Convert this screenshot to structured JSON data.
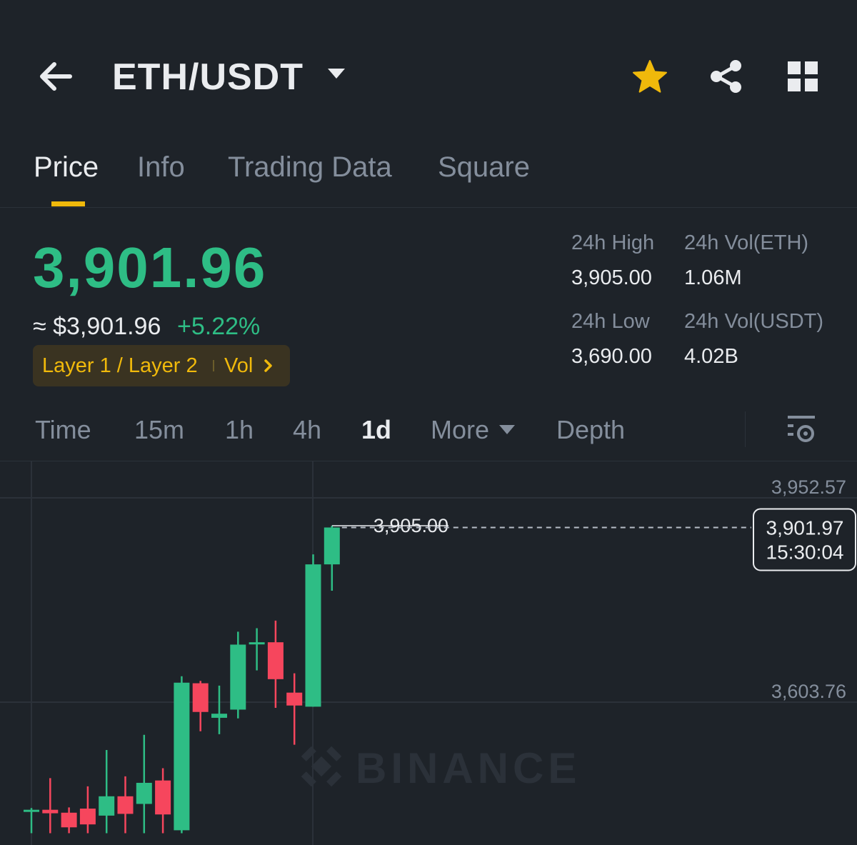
{
  "header": {
    "pair": "ETH/USDT",
    "icons": [
      "arrow-left-icon",
      "caret-down-icon",
      "star-icon",
      "share-icon",
      "grid-icon"
    ],
    "favorite_color": "#f0b90b"
  },
  "tabs": [
    {
      "label": "Price",
      "active": true
    },
    {
      "label": "Info",
      "active": false
    },
    {
      "label": "Trading Data",
      "active": false
    },
    {
      "label": "Square",
      "active": false
    }
  ],
  "ticker": {
    "last_price": "3,901.96",
    "fiat_price": "≈ $3,901.96",
    "change": "+5.22%",
    "tag": "Layer 1 / Layer 2",
    "tag_vol": "Vol",
    "tag_chevron": "›",
    "high_label": "24h High",
    "high_value": "3,905.00",
    "low_label": "24h Low",
    "low_value": "3,690.00",
    "vol_eth_label": "24h Vol(ETH)",
    "vol_eth_value": "1.06M",
    "vol_usdt_label": "24h Vol(USDT)",
    "vol_usdt_value": "4.02B"
  },
  "intervals": {
    "items": [
      "Time",
      "15m",
      "1h",
      "4h",
      "1d",
      "More",
      "Depth"
    ],
    "active": "1d"
  },
  "colors": {
    "up": "#2ebd85",
    "down": "#f6465d",
    "accent": "#f0b90b",
    "background": "#1e2329"
  },
  "chart_data": {
    "type": "candlestick",
    "y_ticks": [
      "3,952.57",
      "3,603.76"
    ],
    "y_tick_values": [
      3952.57,
      3603.76
    ],
    "high_marker": "3,905.00",
    "current_price": "3,901.97",
    "countdown": "15:30:04",
    "watermark": "BINANCE",
    "candles": [
      {
        "o": 3417,
        "h": 3423,
        "l": 3380,
        "c": 3420
      },
      {
        "o": 3420,
        "h": 3474,
        "l": 3380,
        "c": 3414
      },
      {
        "o": 3415,
        "h": 3424,
        "l": 3380,
        "c": 3390
      },
      {
        "o": 3422,
        "h": 3460,
        "l": 3380,
        "c": 3395
      },
      {
        "o": 3410,
        "h": 3522,
        "l": 3380,
        "c": 3443
      },
      {
        "o": 3443,
        "h": 3477,
        "l": 3380,
        "c": 3413
      },
      {
        "o": 3430,
        "h": 3548,
        "l": 3380,
        "c": 3466
      },
      {
        "o": 3470,
        "h": 3491,
        "l": 3380,
        "c": 3412
      },
      {
        "o": 3385,
        "h": 3648,
        "l": 3380,
        "c": 3637
      },
      {
        "o": 3636,
        "h": 3640,
        "l": 3554,
        "c": 3587
      },
      {
        "o": 3577,
        "h": 3632,
        "l": 3549,
        "c": 3584
      },
      {
        "o": 3591,
        "h": 3724,
        "l": 3576,
        "c": 3702
      },
      {
        "o": 3705,
        "h": 3730,
        "l": 3658,
        "c": 3706
      },
      {
        "o": 3706,
        "h": 3743,
        "l": 3594,
        "c": 3643
      },
      {
        "o": 3620,
        "h": 3653,
        "l": 3531,
        "c": 3598
      },
      {
        "o": 3596,
        "h": 3856,
        "l": 3596,
        "c": 3839
      },
      {
        "o": 3839,
        "h": 3905,
        "l": 3794,
        "c": 3901.97
      }
    ]
  }
}
